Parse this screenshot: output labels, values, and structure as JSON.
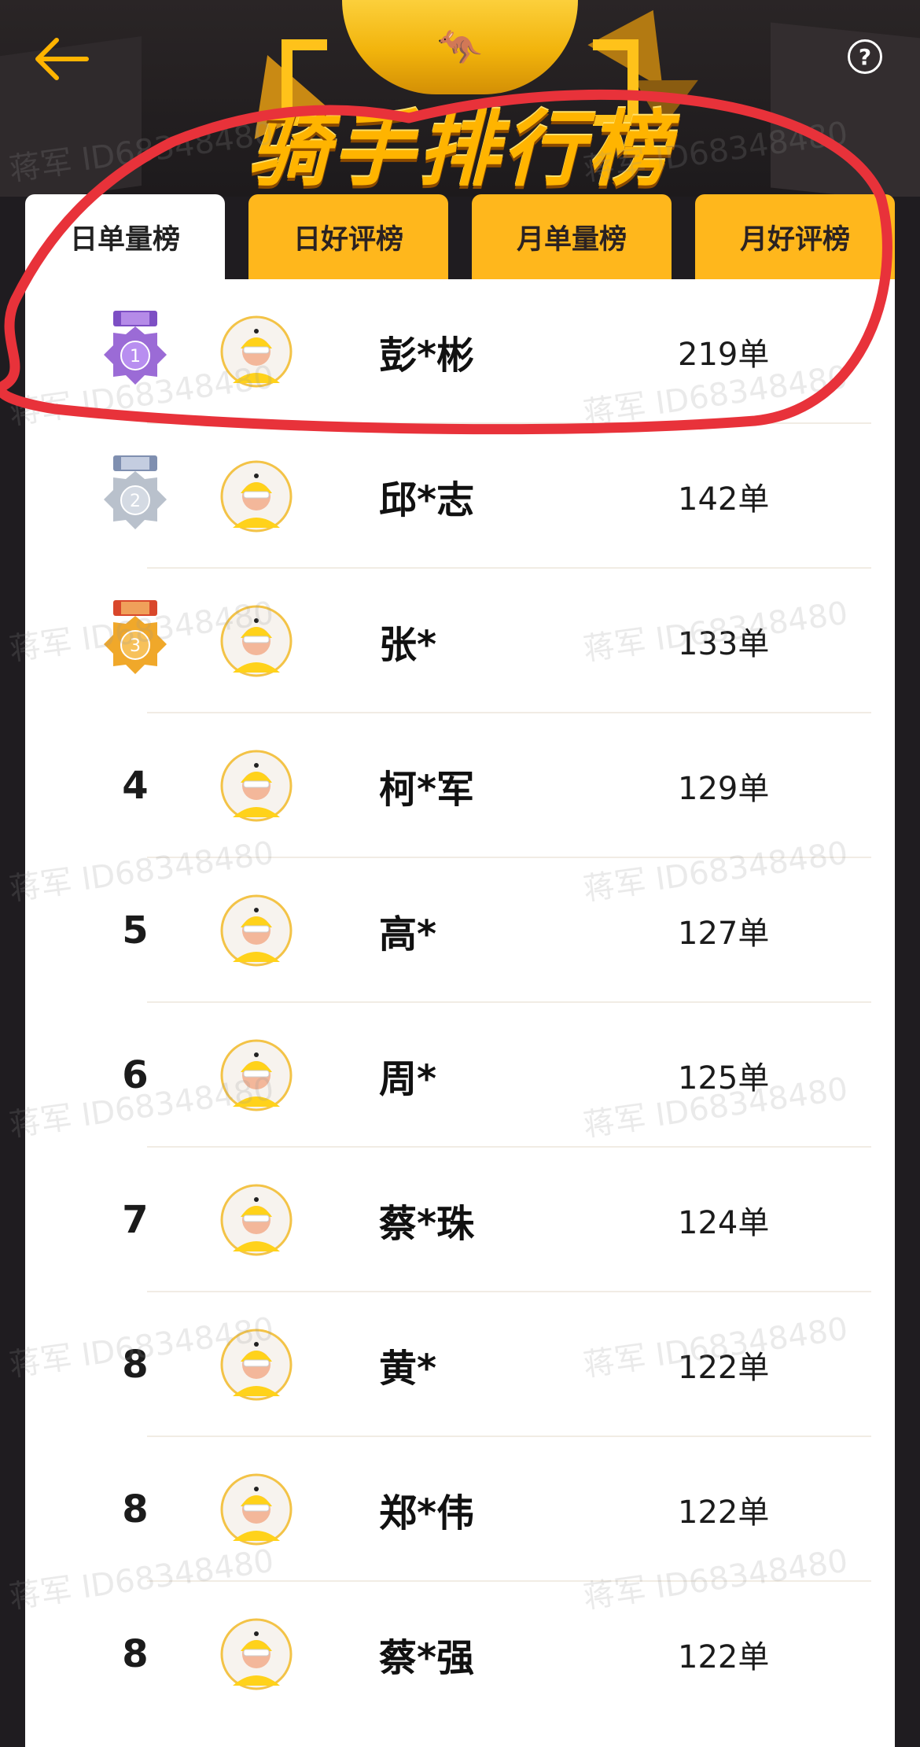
{
  "header": {
    "title": "骑手排行榜",
    "back_icon": "arrow-left-icon",
    "help_label": "?"
  },
  "tabs": [
    {
      "label": "日单量榜",
      "active": true
    },
    {
      "label": "日好评榜",
      "active": false
    },
    {
      "label": "月单量榜",
      "active": false
    },
    {
      "label": "月好评榜",
      "active": false
    }
  ],
  "ranking": [
    {
      "rank": "1",
      "name": "彭*彬",
      "count": "219单",
      "medal": "purple"
    },
    {
      "rank": "2",
      "name": "邱*志",
      "count": "142单",
      "medal": "silver"
    },
    {
      "rank": "3",
      "name": "张*",
      "count": "133单",
      "medal": "bronze"
    },
    {
      "rank": "4",
      "name": "柯*军",
      "count": "129单"
    },
    {
      "rank": "5",
      "name": "高*",
      "count": "127单"
    },
    {
      "rank": "6",
      "name": "周*",
      "count": "125单"
    },
    {
      "rank": "7",
      "name": "蔡*珠",
      "count": "124单"
    },
    {
      "rank": "8",
      "name": "黄*",
      "count": "122单"
    },
    {
      "rank": "8",
      "name": "郑*伟",
      "count": "122单"
    },
    {
      "rank": "8",
      "name": "蔡*强",
      "count": "122单"
    }
  ],
  "watermark": "蒋军 ID68348480",
  "colors": {
    "accent": "#ffb71c",
    "background": "#1f1c20",
    "annotation": "#e8323a",
    "medal_purple": "#9b6bd6",
    "medal_silver": "#b9c1cc",
    "medal_bronze": "#f0a82a"
  }
}
